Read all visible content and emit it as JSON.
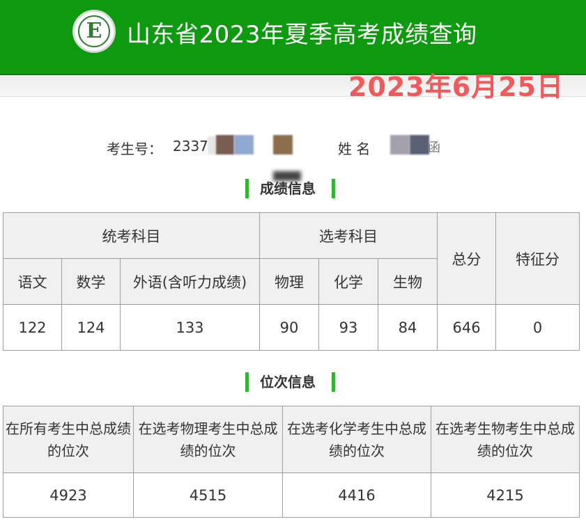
{
  "header": {
    "title": "山东省2023年夏季高考成绩查询",
    "logo_icon": "exam-authority-seal-icon",
    "logo_letter": "E",
    "background_color": "#0e9a0e"
  },
  "date_stamp": "2023年6月25日",
  "candidate": {
    "exam_no_label": "考生号：",
    "exam_no_visible": "2337",
    "name_label": "姓 名",
    "name_visible_tail": "函"
  },
  "score_section": {
    "title": "成绩信息",
    "unified_label": "统考科目",
    "elective_label": "选考科目",
    "total_label": "总分",
    "bonus_label": "特征分",
    "subjects": [
      {
        "label": "语文",
        "value": "122"
      },
      {
        "label": "数学",
        "value": "124"
      },
      {
        "label": "外语(含听力成绩)",
        "value": "133"
      },
      {
        "label": "物理",
        "value": "90"
      },
      {
        "label": "化学",
        "value": "93"
      },
      {
        "label": "生物",
        "value": "84"
      }
    ],
    "total": "646",
    "bonus": "0"
  },
  "rank_section": {
    "title": "位次信息",
    "columns": [
      {
        "label": "在所有考生中总成绩的位次",
        "value": "4923"
      },
      {
        "label": "在选考物理考生中总成绩的位次",
        "value": "4515"
      },
      {
        "label": "在选考化学考生中总成绩的位次",
        "value": "4416"
      },
      {
        "label": "在选考生物考生中总成绩的位次",
        "value": "4215"
      }
    ]
  },
  "accent_color": "#33b533",
  "stamp_color": "#f05a5a"
}
